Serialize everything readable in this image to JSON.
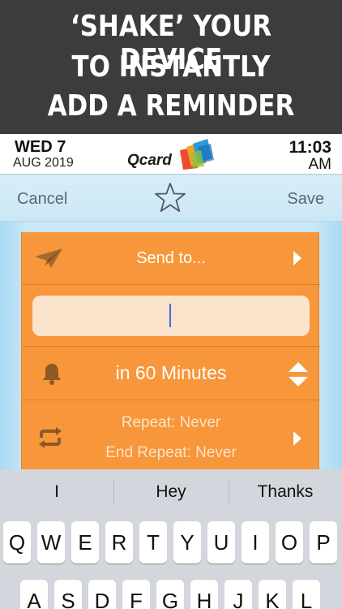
{
  "promo": {
    "line1": "‘SHAKE’ YOUR DEVICE",
    "line2": "TO INSTANTLY",
    "line3": "ADD A REMINDER"
  },
  "status": {
    "day": "WED 7",
    "month": "AUG 2019",
    "time": "11:03",
    "ampm": "AM"
  },
  "brand": "Qcard",
  "nav": {
    "cancel": "Cancel",
    "save": "Save",
    "star_icon": "star-outline-icon"
  },
  "form": {
    "send_to": "Send to...",
    "message_value": "",
    "reminder_time": "in 60 Minutes",
    "repeat": "Repeat: Never",
    "end_repeat": "End Repeat: Never"
  },
  "keyboard": {
    "suggestions": [
      "I",
      "Hey",
      "Thanks"
    ],
    "row1": [
      "Q",
      "W",
      "E",
      "R",
      "T",
      "Y",
      "U",
      "I",
      "O",
      "P"
    ],
    "row2": [
      "A",
      "S",
      "D",
      "F",
      "G",
      "H",
      "J",
      "K",
      "L"
    ]
  },
  "colors": {
    "accent_orange": "#f7963a",
    "nav_blue": "#cce7f5",
    "caret": "#3b6fd8"
  }
}
